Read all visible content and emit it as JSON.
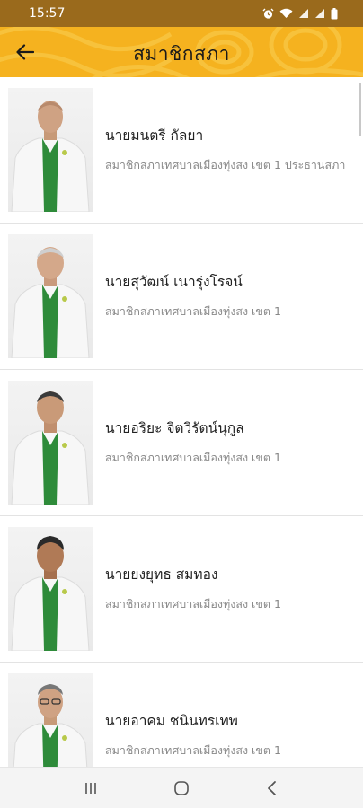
{
  "status_bar": {
    "time": "15:57",
    "icons": [
      "alarm-icon",
      "wifi-icon",
      "signal-icon",
      "signal-icon",
      "battery-icon"
    ]
  },
  "app_bar": {
    "title": "สมาชิกสภา",
    "back_icon": "arrow-left-icon",
    "color": "#f5b21f"
  },
  "members": [
    {
      "name": "นายมนตรี กัลยา",
      "position": "สมาชิกสภาเทศบาลเมืองทุ่งสง เขต 1 ประธานสภา"
    },
    {
      "name": "นายสุวัฒน์ เนารุ่งโรจน์",
      "position": "สมาชิกสภาเทศบาลเมืองทุ่งสง เขต 1"
    },
    {
      "name": "นายอริยะ จิตวิรัตน์นุกูล",
      "position": "สมาชิกสภาเทศบาลเมืองทุ่งสง เขต 1"
    },
    {
      "name": "นายยงยุทธ สมทอง",
      "position": "สมาชิกสภาเทศบาลเมืองทุ่งสง เขต 1"
    },
    {
      "name": "นายอาคม ชนินทรเทพ",
      "position": "สมาชิกสภาเทศบาลเมืองทุ่งสง เขต 1"
    }
  ],
  "nav_bar": {
    "icons": [
      "recent-apps-icon",
      "home-icon",
      "back-icon"
    ]
  }
}
